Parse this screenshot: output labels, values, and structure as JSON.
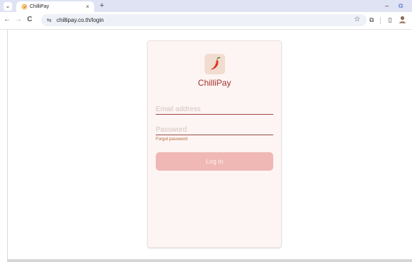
{
  "browser": {
    "tab": {
      "title": "ChilliPay",
      "close_glyph": "×",
      "favicon": "chilli-icon"
    },
    "tab_menu_glyph": "⌄",
    "new_tab_glyph": "+",
    "window_controls": {
      "minimize_glyph": "–",
      "restore_glyph": "⧉"
    },
    "toolbar": {
      "back_glyph": "←",
      "forward_glyph": "→",
      "reload_glyph": "C",
      "site_info_glyph": "⇆",
      "url": "chillipay.co.th/login",
      "bookmark_glyph": "☆",
      "extensions_glyph": "⧉",
      "sidepanel_glyph": "▯"
    }
  },
  "login": {
    "brand_name": "ChilliPay",
    "email_placeholder": "Email address",
    "email_value": "",
    "password_placeholder": "Password",
    "password_value": "",
    "forgot_password_label": "Forgot password",
    "login_button_label": "Log in"
  },
  "colors": {
    "brand": "#a3322a",
    "chilli_red": "#d8321f",
    "button_disabled": "#f0b8b5",
    "card_background": "#fdf5f3",
    "field_underline": "#9b4a47",
    "forgot_link": "#b5683a",
    "tabstrip": "#dfe3f3"
  }
}
